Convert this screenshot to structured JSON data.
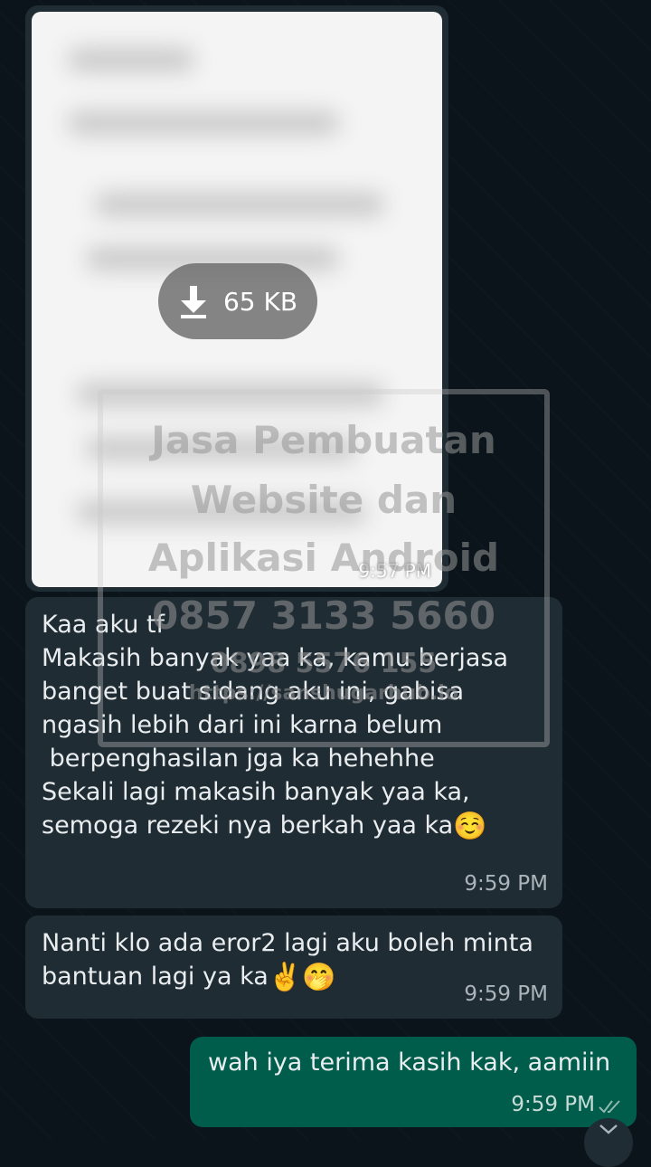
{
  "image_message": {
    "size_label": "65 KB",
    "time": "9:57 PM"
  },
  "watermark": {
    "line1": "Jasa Pembuatan",
    "line2": "Website dan",
    "line3": "Aplikasi Android",
    "line4": "0857 3133 5660",
    "line5": "0898 5576 155",
    "line6": "https://sanshugarhub.io"
  },
  "messages": [
    {
      "text": "Kaa aku tf\nMakasih banyak yaa ka, kamu berjasa\nbanget buat sidang aku ini, gabisa\nngasih lebih dari ini karna belum\n berpenghasilan jga ka hehehhe\nSekali lagi makasih banyak yaa ka,\nsemoga rezeki nya berkah yaa ka",
      "emoji": "☺️",
      "time": "9:59 PM"
    },
    {
      "text": "Nanti klo ada eror2 lagi aku boleh minta\nbantuan lagi ya ka",
      "emoji": "✌️🤭",
      "time": "9:59 PM"
    },
    {
      "text": "wah iya terima kasih kak, aamiin",
      "time": "9:59 PM",
      "status_icon": "double-check-icon"
    }
  ],
  "colors": {
    "background": "#0b141a",
    "incoming_bubble": "#202c33",
    "outgoing_bubble": "#005c4b"
  }
}
